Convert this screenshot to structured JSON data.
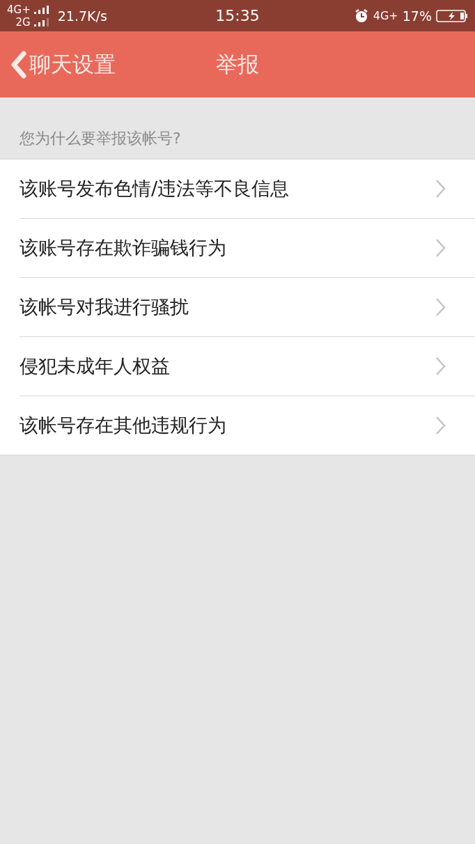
{
  "status_bar": {
    "network_1": "4G+",
    "network_2": "2G",
    "speed": "21.7K/s",
    "time": "15:35",
    "network_3": "4G+",
    "battery": "17%"
  },
  "nav_bar": {
    "back_label": "聊天设置",
    "title": "举报"
  },
  "section_label": "您为什么要举报该帐号?",
  "options": [
    {
      "label": "该账号发布色情/违法等不良信息"
    },
    {
      "label": "该账号存在欺诈骗钱行为"
    },
    {
      "label": "该帐号对我进行骚扰"
    },
    {
      "label": "侵犯未成年人权益"
    },
    {
      "label": "该帐号存在其他违规行为"
    }
  ]
}
